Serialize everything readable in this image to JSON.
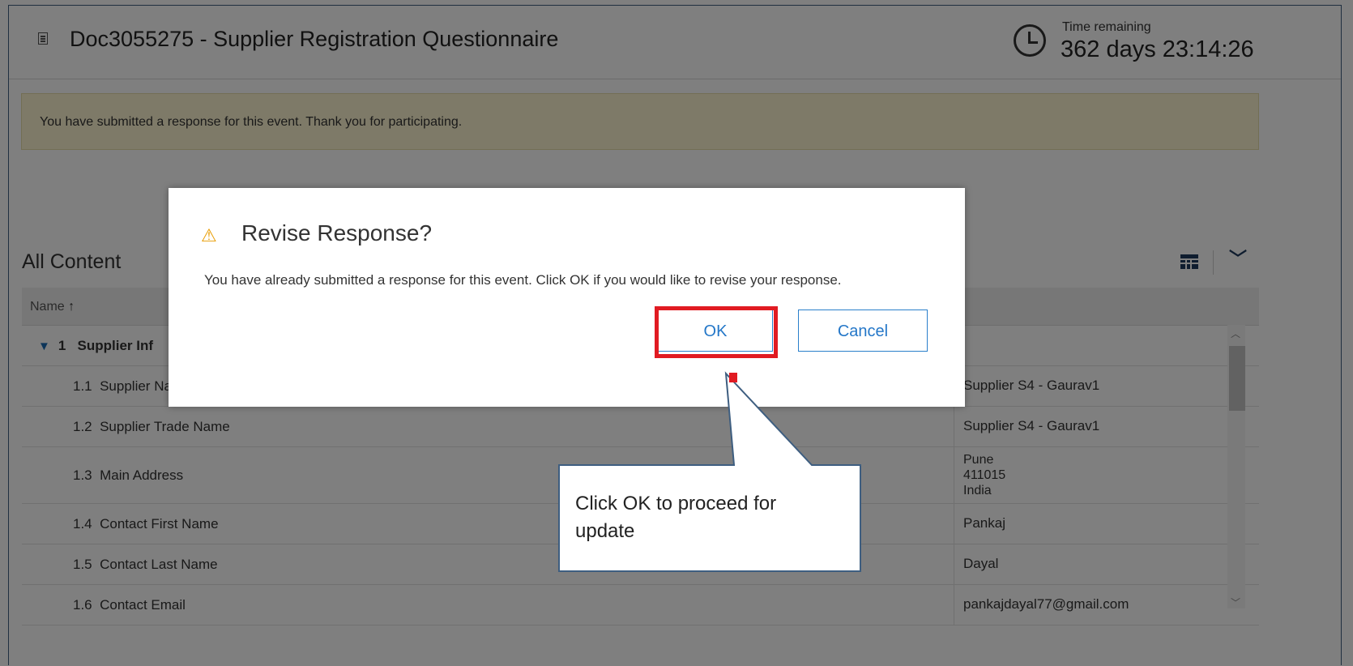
{
  "header": {
    "doc_title": "Doc3055275 - Supplier Registration Questionnaire",
    "time_label": "Time remaining",
    "time_value": "362 days 23:14:26"
  },
  "banner": {
    "message": "You have submitted a response for this event.  Thank you for participating."
  },
  "content": {
    "section_title": "All Content",
    "table": {
      "name_header": "Name",
      "sort_arrow": "↑",
      "group": {
        "number": "1",
        "label": "Supplier Inf"
      },
      "rows": [
        {
          "number": "1.1",
          "name": "Supplier Name",
          "value": "Supplier S4 - Gaurav1"
        },
        {
          "number": "1.2",
          "name": "Supplier Trade  Name",
          "value": "Supplier S4 - Gaurav1"
        },
        {
          "number": "1.3",
          "name": "Main Address",
          "value_lines": [
            "Pune",
            "411015",
            "India"
          ]
        },
        {
          "number": "1.4",
          "name": "Contact First Name",
          "value": "Pankaj"
        },
        {
          "number": "1.5",
          "name": "Contact Last Name",
          "value": "Dayal"
        },
        {
          "number": "1.6",
          "name": "Contact Email",
          "value": "pankajdayal77@gmail.com"
        }
      ]
    }
  },
  "dialog": {
    "title": "Revise Response?",
    "message": "You have already submitted a response for this event. Click OK if you would like to revise your response.",
    "ok_label": "OK",
    "cancel_label": "Cancel"
  },
  "callout": {
    "text": "Click OK to proceed for update"
  },
  "colors": {
    "accent": "#2477c8",
    "highlight": "#e11b22",
    "banner": "#fcf4d0",
    "warning": "#e89b00"
  },
  "icons": [
    "document-icon",
    "clock-icon",
    "table-view-icon",
    "expand-all-icon",
    "warning-icon",
    "triangle-down-icon"
  ]
}
